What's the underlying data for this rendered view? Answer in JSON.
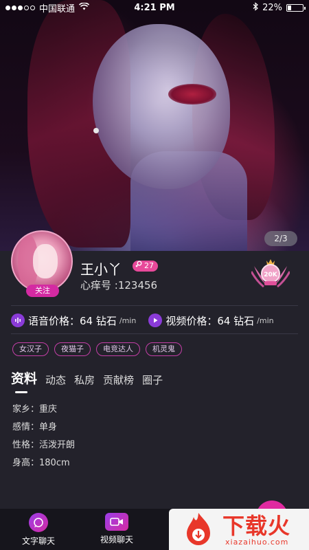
{
  "status_bar": {
    "carrier": "中国联通",
    "time": "4:21 PM",
    "battery_percent": "22%",
    "battery_level": 0.22,
    "signal_icons": [
      "signal-dot",
      "signal-dot",
      "signal-dot",
      "signal-dot-empty",
      "signal-dot-empty"
    ]
  },
  "gallery": {
    "page_indicator": "2/3"
  },
  "profile": {
    "follow_label": "关注",
    "name": "王小丫",
    "level": "27",
    "id_line": "心痒号 :123456",
    "rank_badge_text": "20K"
  },
  "prices": {
    "voice_label": "语音价格：64 钻石",
    "voice_unit": "/min",
    "video_label": "视频价格：64 钻石",
    "video_unit": "/min"
  },
  "tags": [
    "女汉子",
    "夜猫子",
    "电竞达人",
    "机灵鬼"
  ],
  "tabs": [
    "资料",
    "动态",
    "私房",
    "贡献榜",
    "圈子"
  ],
  "info": {
    "rows": [
      "家乡：重庆",
      "感情：单身",
      "性格：活泼开朗",
      "身高：180cm"
    ]
  },
  "bottom_nav": {
    "text_chat": "文字聊天",
    "video_chat": "视频聊天"
  },
  "watermark": {
    "title": "下载火",
    "url": "xiazaihuo.com"
  },
  "colors": {
    "accent": "#d42aa2",
    "background": "#23222b",
    "tag_border": "#c53fa8"
  }
}
